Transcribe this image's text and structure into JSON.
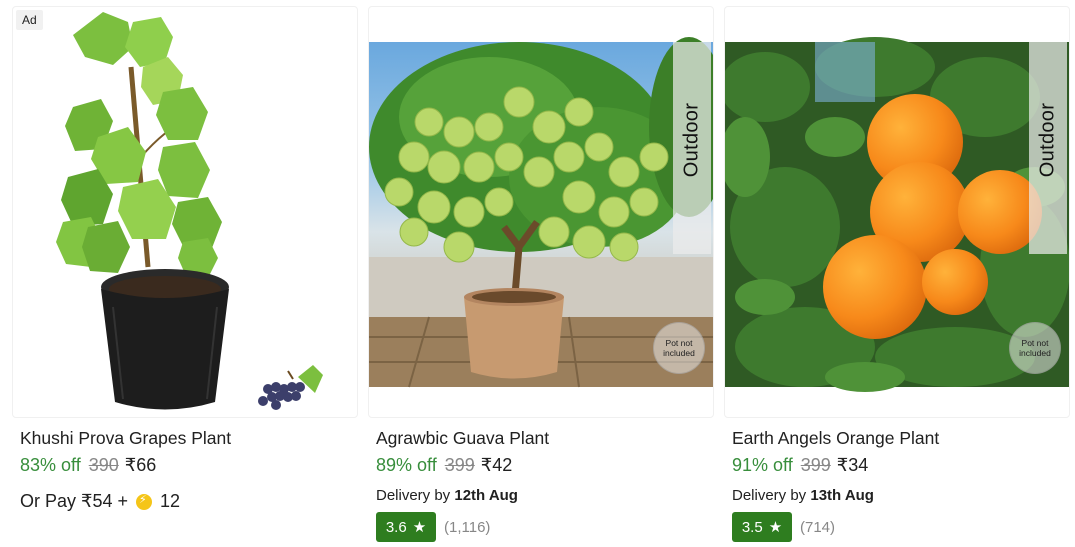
{
  "products": [
    {
      "ad_label": "Ad",
      "name": "Khushi Prova Grapes Plant",
      "discount": "83% off",
      "mrp": "390",
      "price": "₹66",
      "pay_prefix": "Or Pay ₹54 +",
      "coins": "12"
    },
    {
      "name": "Agrawbic Guava Plant",
      "discount": "89% off",
      "mrp": "399",
      "price": "₹42",
      "tag": "Outdoor",
      "pot_note": "Pot not included",
      "delivery_prefix": "Delivery by",
      "delivery_date": "12th Aug",
      "rating": "3.6",
      "rating_count": "(1,116)"
    },
    {
      "name": "Earth Angels Orange Plant",
      "discount": "91% off",
      "mrp": "399",
      "price": "₹34",
      "tag": "Outdoor",
      "pot_note": "Pot not included",
      "delivery_prefix": "Delivery by",
      "delivery_date": "13th Aug",
      "rating": "3.5",
      "rating_count": "(714)"
    }
  ],
  "icons": {
    "star": "★",
    "coin": "supercoin-icon"
  },
  "colors": {
    "discount": "#388e3c",
    "rating_badge": "#2e7d1f",
    "mrp": "#878787"
  }
}
